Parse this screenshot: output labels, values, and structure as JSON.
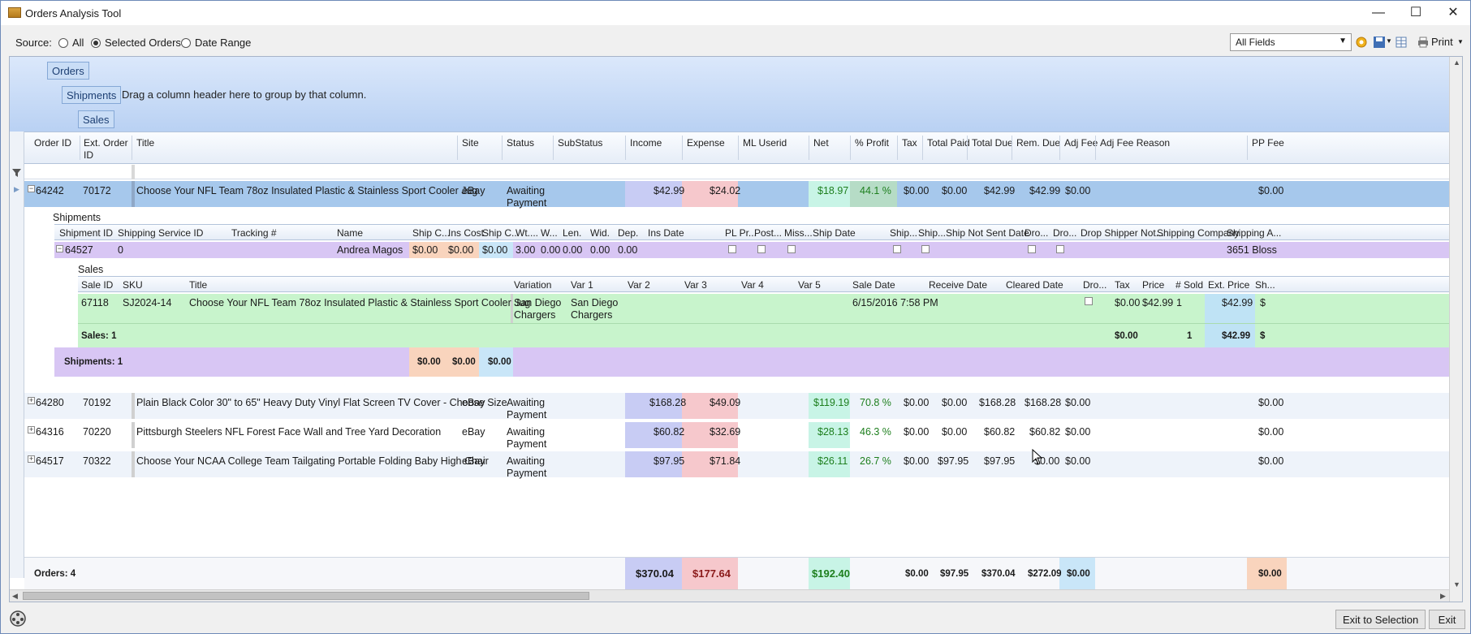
{
  "window": {
    "title": "Orders Analysis Tool",
    "minimize": "—",
    "maximize": "☐",
    "close": "✕"
  },
  "toolbar": {
    "source_label": "Source:",
    "radio_all": "All",
    "radio_selected": "Selected Orders",
    "radio_date": "Date Range",
    "selected_radio": "Selected Orders",
    "fields_select": "All Fields",
    "print_label": "Print"
  },
  "group_panel": {
    "chip_orders": "Orders",
    "chip_shipments": "Shipments",
    "chip_sales": "Sales",
    "hint": "Drag a column header here to group by that column."
  },
  "order_columns": [
    "Order ID",
    "Ext. Order ID",
    "Title",
    "Site",
    "Status",
    "SubStatus",
    "Income",
    "Expense",
    "ML Userid",
    "Net",
    "% Profit",
    "Tax",
    "Total Paid",
    "Total Due",
    "Rem. Due",
    "Adj Fee",
    "Adj Fee Reason",
    "PP Fee"
  ],
  "order_col_lines": {
    "ext_order_id_1": "Ext. Order",
    "ext_order_id_2": "ID"
  },
  "orders": [
    {
      "id": "64242",
      "ext": "70172",
      "title": "Choose Your NFL Team 78oz Insulated Plastic & Stainless Sport Cooler Jug",
      "site": "eBay",
      "status1": "Awaiting",
      "status2": "Payment",
      "income": "$42.99",
      "expense": "$24.02",
      "net": "$18.97",
      "profit": "44.1 %",
      "tax": "$0.00",
      "paid": "$0.00",
      "due": "$42.99",
      "rem": "$42.99",
      "adj": "$0.00",
      "pp": "$0.00"
    },
    {
      "id": "64280",
      "ext": "70192",
      "title": "Plain Black Color 30\" to 65\" Heavy Duty Vinyl Flat Screen TV Cover - Choose Size",
      "site": "eBay",
      "status1": "Awaiting",
      "status2": "Payment",
      "income": "$168.28",
      "expense": "$49.09",
      "net": "$119.19",
      "profit": "70.8 %",
      "tax": "$0.00",
      "paid": "$0.00",
      "due": "$168.28",
      "rem": "$168.28",
      "adj": "$0.00",
      "pp": "$0.00"
    },
    {
      "id": "64316",
      "ext": "70220",
      "title": "Pittsburgh Steelers NFL Forest Face Wall and Tree Yard Decoration",
      "site": "eBay",
      "status1": "Awaiting",
      "status2": "Payment",
      "income": "$60.82",
      "expense": "$32.69",
      "net": "$28.13",
      "profit": "46.3 %",
      "tax": "$0.00",
      "paid": "$0.00",
      "due": "$60.82",
      "rem": "$60.82",
      "adj": "$0.00",
      "pp": "$0.00"
    },
    {
      "id": "64517",
      "ext": "70322",
      "title": "Choose Your NCAA College Team Tailgating Portable Folding Baby High Chair",
      "site": "eBay",
      "status1": "Awaiting",
      "status2": "Payment",
      "income": "$97.95",
      "expense": "$71.84",
      "net": "$26.11",
      "profit": "26.7 %",
      "tax": "$0.00",
      "paid": "$97.95",
      "due": "$97.95",
      "rem": "$0.00",
      "adj": "$0.00",
      "pp": "$0.00"
    }
  ],
  "shipments": {
    "label": "Shipments",
    "columns": [
      "Shipment ID",
      "Shipping Service ID",
      "Tracking #",
      "Name",
      "Ship C...",
      "Ins Cost",
      "Ship C...",
      "Wt....",
      "W...",
      "Len.",
      "Wid.",
      "Dep.",
      "Ins Date",
      "PL Pr...",
      "Post...",
      "Miss...",
      "Ship Date",
      "Ship...",
      "Ship...",
      "Ship Not Sent Date",
      "Dro...",
      "Dro...",
      "Drop Shipper Not...",
      "Shipping Company",
      "Shipping A..."
    ],
    "row": {
      "id": "64527",
      "service": "0",
      "name": "Andrea Magos",
      "ship_cost": "$0.00",
      "ins_cost": "$0.00",
      "ship_charge": "$0.00",
      "wt": "3.00",
      "w": "0.00",
      "len": "0.00",
      "wid": "0.00",
      "dep": "0.00",
      "address": "3651 Bloss"
    },
    "footer_label": "Shipments: 1",
    "footer_vals": [
      "$0.00",
      "$0.00",
      "$0.00"
    ]
  },
  "sales": {
    "label": "Sales",
    "columns": [
      "Sale ID",
      "SKU",
      "Title",
      "Variation",
      "Var 1",
      "Var 2",
      "Var 3",
      "Var 4",
      "Var 5",
      "Sale Date",
      "Receive Date",
      "Cleared Date",
      "Dro...",
      "Tax",
      "Price",
      "# Sold",
      "Ext. Price",
      "Sh..."
    ],
    "row": {
      "id": "67118",
      "sku": "SJ2024-14",
      "title": "Choose Your NFL Team 78oz Insulated Plastic & Stainless Sport Cooler Jug",
      "variation1": "San Diego",
      "variation2": "Chargers",
      "var1_1": "San Diego",
      "var1_2": "Chargers",
      "sale_date": "6/15/2016 7:58 PM",
      "tax": "$0.00",
      "price": "$42.99",
      "sold": "1",
      "ext_price": "$42.99",
      "sh": "$"
    },
    "footer_label": "Sales: 1",
    "footer_tax": "$0.00",
    "footer_sold": "1",
    "footer_ext": "$42.99",
    "footer_sh": "$"
  },
  "totals": {
    "label": "Orders: 4",
    "income": "$370.04",
    "expense": "$177.64",
    "net": "$192.40",
    "tax": "$0.00",
    "paid": "$97.95",
    "due": "$370.04",
    "rem": "$272.09",
    "adj": "$0.00",
    "pp": "$0.00"
  },
  "buttons": {
    "exit_to_selection": "Exit to Selection",
    "exit": "Exit"
  },
  "colors": {
    "income_bg": "#c8ccf4",
    "expense_bg": "#f6c8cc",
    "net_bg": "#c8f4e6",
    "selected_row": "#a6c8ec",
    "shipment_bg": "#d8c6f4",
    "sale_bg": "#c8f4cc",
    "ship_cost_bg": "#f9d4bd",
    "ship_charge_bg": "#c9e6f8"
  }
}
